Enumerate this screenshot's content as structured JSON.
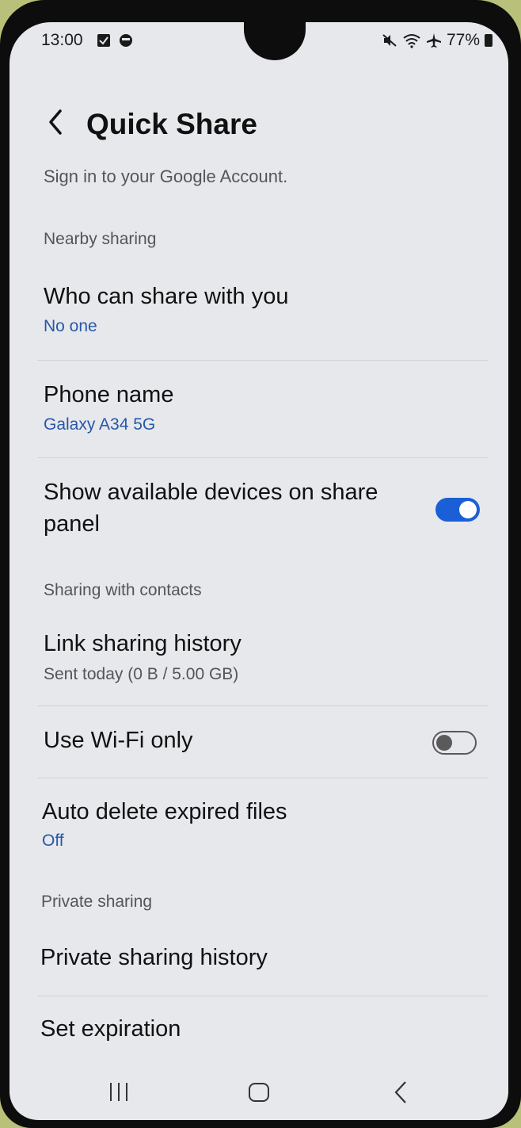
{
  "status": {
    "time": "13:00",
    "battery": "77%",
    "icons": [
      "notification-box-icon",
      "messenger-icon",
      "mute-icon",
      "wifi-icon",
      "airplane-icon",
      "battery-icon"
    ]
  },
  "header": {
    "title": "Quick Share",
    "back_icon": "chevron-left-icon"
  },
  "account": {
    "text": "Sign in to your Google Account."
  },
  "sections": {
    "nearby": "Nearby sharing",
    "contacts": "Sharing with contacts",
    "private": "Private sharing"
  },
  "items": {
    "who_can_share": {
      "title": "Who can share with you",
      "value": "No one"
    },
    "phone_name": {
      "title": "Phone name",
      "value": "Galaxy A34 5G"
    },
    "show_devices": {
      "title_line1": "Show available devices on share",
      "title_line2": "panel",
      "enabled": true
    },
    "link_history": {
      "title": "Link sharing history",
      "value": "Sent today (0 B / 5.00 GB)"
    },
    "wifi_only": {
      "title": "Use Wi-Fi only",
      "enabled": false
    },
    "auto_delete": {
      "title": "Auto delete expired files",
      "value": "Off"
    },
    "private_history": {
      "title": "Private sharing history"
    },
    "set_expiration": {
      "title": "Set expiration"
    }
  },
  "colors": {
    "accent": "#1a5fd6",
    "link_blue": "#2857a8",
    "background": "#e6e8ec"
  },
  "navbar": {
    "icons": [
      "recents-icon",
      "home-icon",
      "back-icon"
    ]
  }
}
